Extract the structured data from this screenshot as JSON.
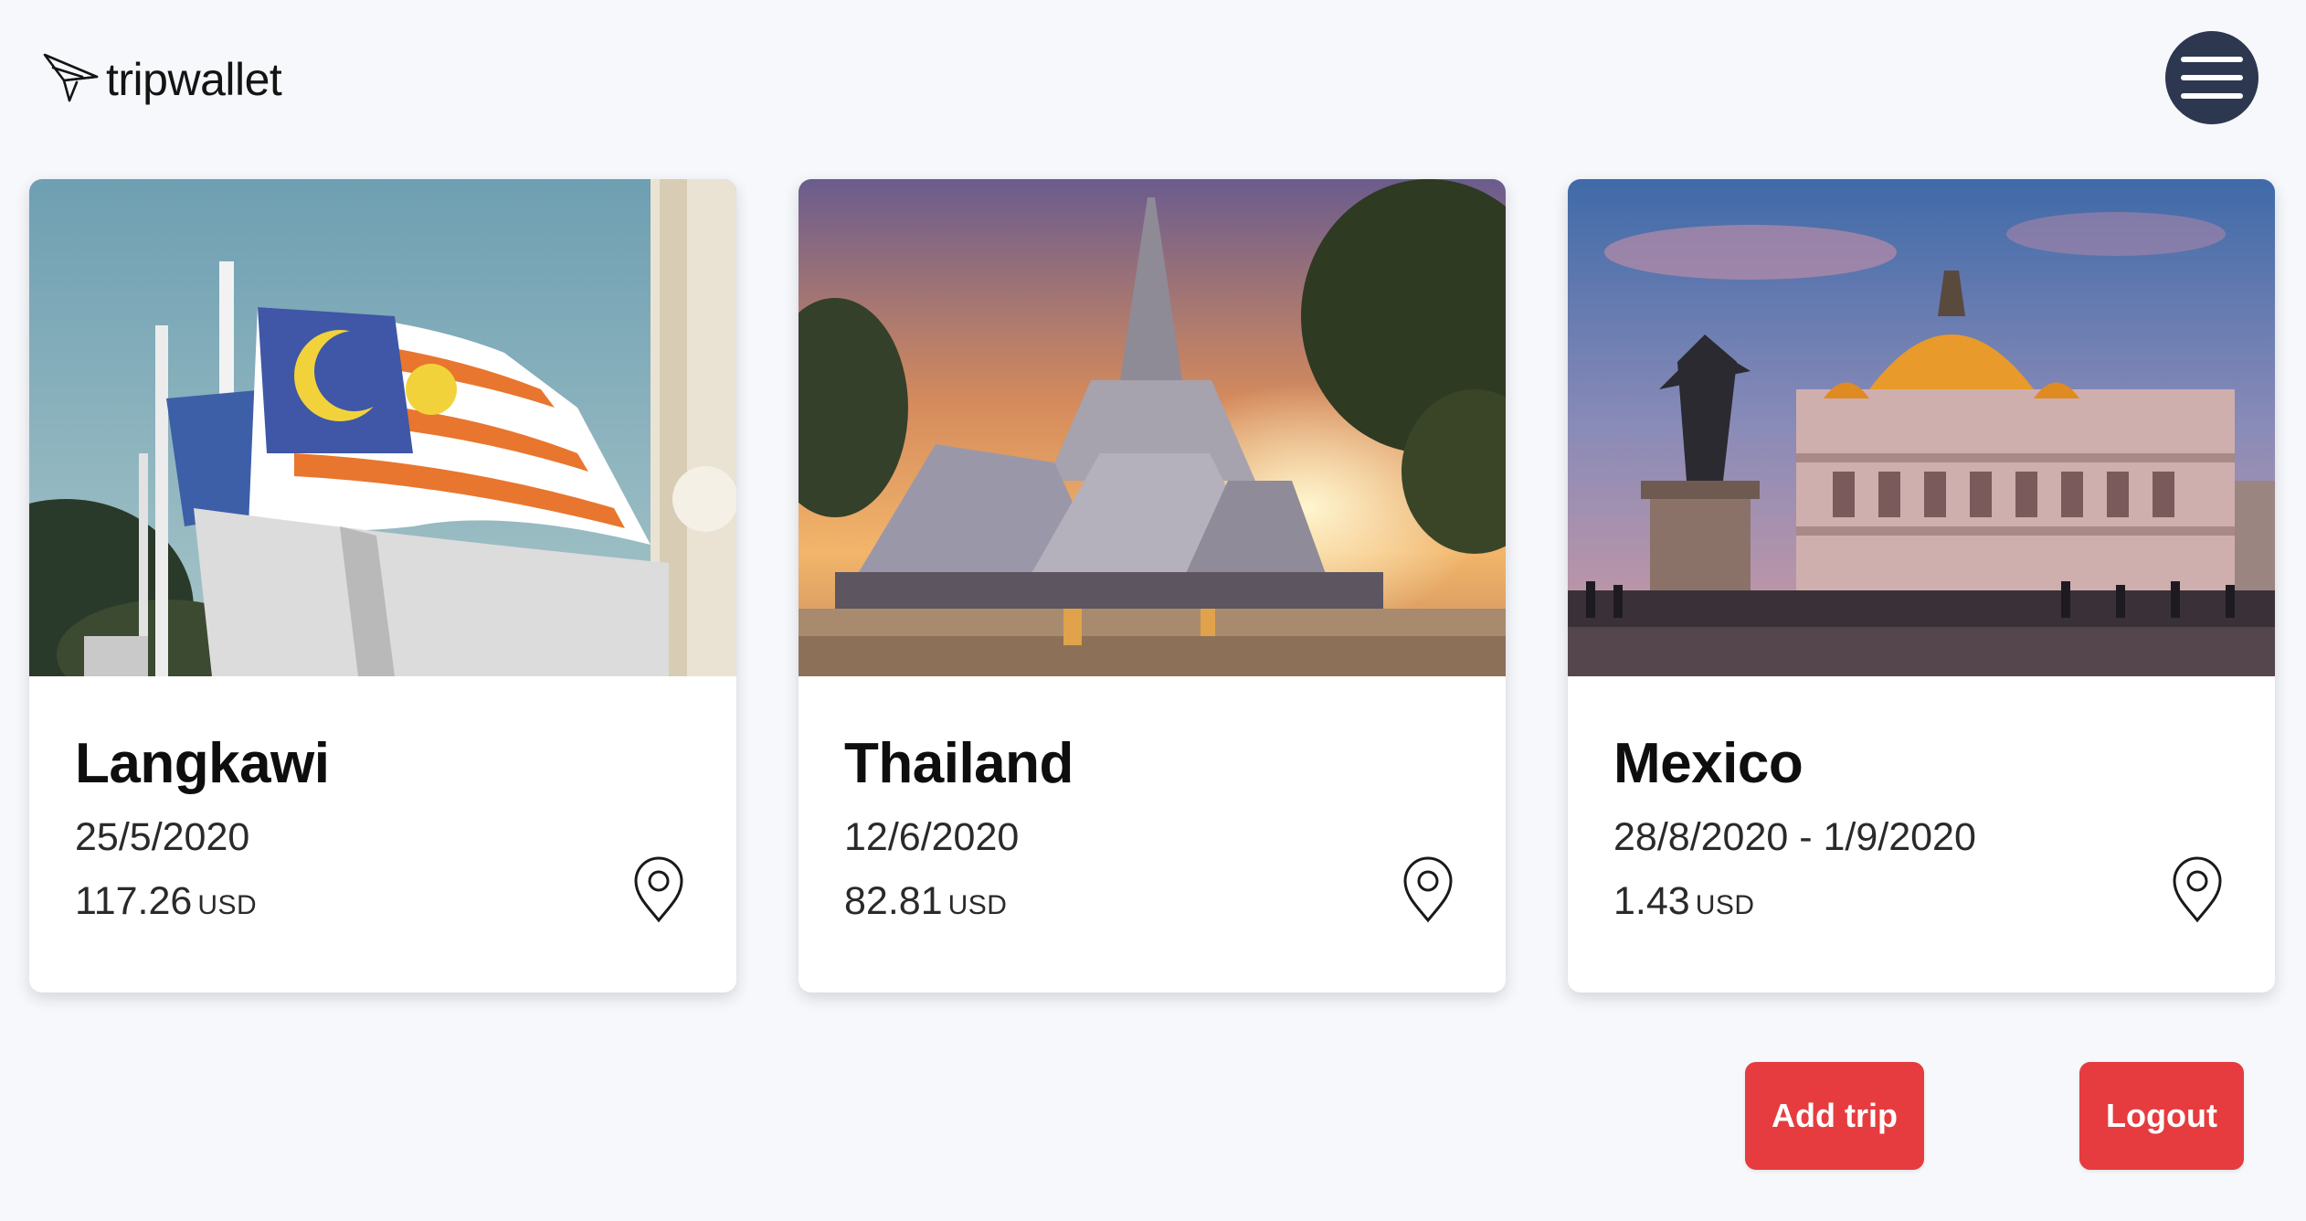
{
  "header": {
    "logo_text": "tripwallet",
    "logo_icon": "paper-plane-icon",
    "menu_icon": "hamburger-menu-icon"
  },
  "trips": [
    {
      "name": "Langkawi",
      "dates": "25/5/2020",
      "amount": "117.26",
      "currency": "USD",
      "image": "malaysian-flags-photo"
    },
    {
      "name": "Thailand",
      "dates": "12/6/2020",
      "amount": "82.81",
      "currency": "USD",
      "image": "thai-temple-sunset-photo"
    },
    {
      "name": "Mexico",
      "dates": "28/8/2020 - 1/9/2020",
      "amount": "1.43",
      "currency": "USD",
      "image": "palacio-bellas-artes-photo"
    }
  ],
  "actions": {
    "add_trip": "Add trip",
    "logout": "Logout"
  },
  "colors": {
    "background": "#f6f8fb",
    "menu_button": "#2d3750",
    "action_button": "#e63c3f",
    "card": "#ffffff"
  }
}
